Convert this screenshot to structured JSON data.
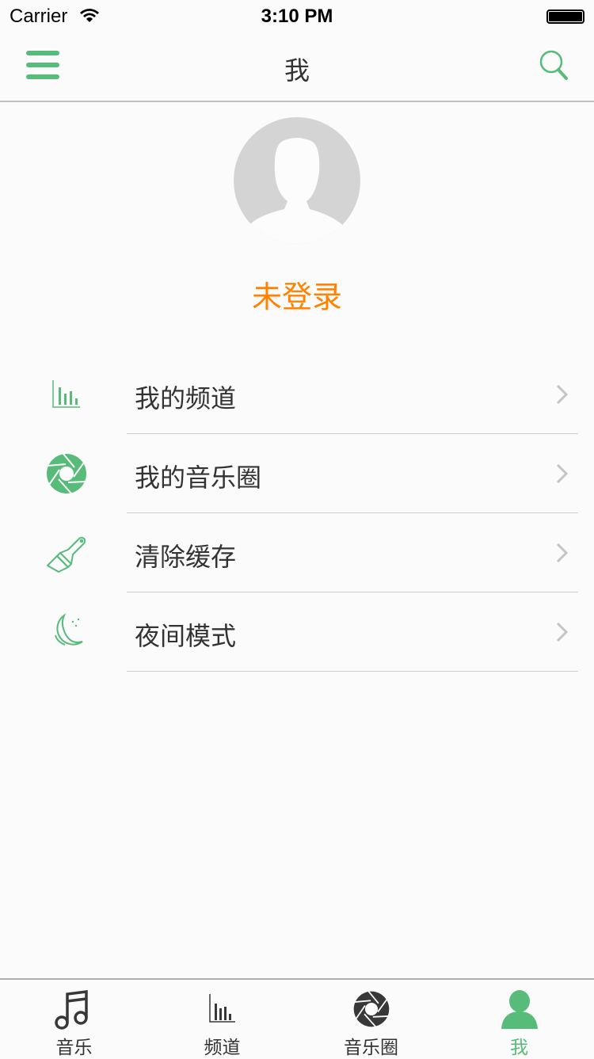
{
  "status_bar": {
    "carrier": "Carrier",
    "time": "3:10 PM"
  },
  "nav": {
    "title": "我"
  },
  "profile": {
    "username": "未登录"
  },
  "menu": [
    {
      "label": "我的频道",
      "icon": "bar-chart-icon"
    },
    {
      "label": "我的音乐圈",
      "icon": "aperture-icon"
    },
    {
      "label": "清除缓存",
      "icon": "brush-icon"
    },
    {
      "label": "夜间模式",
      "icon": "moon-icon"
    }
  ],
  "tabs": [
    {
      "label": "音乐",
      "icon": "music-note-icon"
    },
    {
      "label": "频道",
      "icon": "bar-chart-icon"
    },
    {
      "label": "音乐圈",
      "icon": "aperture-icon"
    },
    {
      "label": "我",
      "icon": "person-icon",
      "active": true
    }
  ],
  "colors": {
    "accent": "#57bb7a",
    "username": "#ff8200",
    "text": "#333333"
  }
}
